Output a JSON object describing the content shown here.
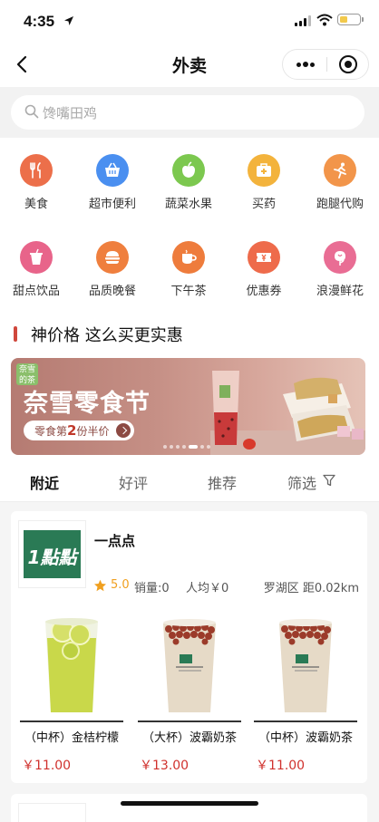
{
  "status_bar": {
    "time": "4:35"
  },
  "nav": {
    "title": "外卖"
  },
  "search": {
    "placeholder": "馋嘴田鸡"
  },
  "categories": [
    {
      "label": "美食",
      "icon": "food-icon",
      "color": "#ec6f4a"
    },
    {
      "label": "超市便利",
      "icon": "basket-icon",
      "color": "#4a8ff0"
    },
    {
      "label": "蔬菜水果",
      "icon": "apple-icon",
      "color": "#7cc84f"
    },
    {
      "label": "买药",
      "icon": "medicine-box-icon",
      "color": "#f3b33c"
    },
    {
      "label": "跑腿代购",
      "icon": "runner-icon",
      "color": "#f2954a"
    },
    {
      "label": "甜点饮品",
      "icon": "drink-cup-icon",
      "color": "#e8648a"
    },
    {
      "label": "品质晚餐",
      "icon": "burger-icon",
      "color": "#ef7f3e"
    },
    {
      "label": "下午茶",
      "icon": "tea-cup-icon",
      "color": "#ee7c3c"
    },
    {
      "label": "优惠券",
      "icon": "coupon-icon",
      "color": "#ee6b4b"
    },
    {
      "label": "浪漫鲜花",
      "icon": "rose-icon",
      "color": "#e96d94"
    }
  ],
  "section": {
    "title": "神价格 这么买更实惠"
  },
  "banner": {
    "brand": "奈雪的茶",
    "title": "奈雪零食节",
    "promo_prefix": "零食第",
    "promo_num": "2",
    "promo_suffix": "份半价"
  },
  "tabs": [
    {
      "label": "附近",
      "active": true
    },
    {
      "label": "好评",
      "active": false
    },
    {
      "label": "推荐",
      "active": false
    },
    {
      "label": "筛选",
      "active": false
    }
  ],
  "store": {
    "name": "一点点",
    "logo_text": "1點點",
    "rating": "5.0",
    "sales": "销量:0",
    "avg_price": "人均￥0",
    "location": "罗湖区 距0.02km",
    "products": [
      {
        "name": "（中杯）金桔柠檬",
        "price": "￥11.00",
        "drink": "lemon"
      },
      {
        "name": "（大杯）波霸奶茶",
        "price": "￥13.00",
        "drink": "milk-tea"
      },
      {
        "name": "（中杯）波霸奶茶",
        "price": "￥11.00",
        "drink": "milk-tea"
      }
    ]
  },
  "colors": {
    "accent_red": "#d0312d",
    "section_bar": "#d0473c",
    "star": "#f0a020"
  }
}
